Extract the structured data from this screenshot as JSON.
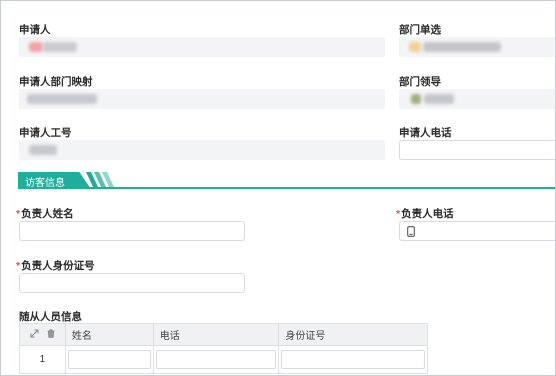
{
  "applicant_section": {
    "applicant": {
      "label": "申请人"
    },
    "dept_select": {
      "label": "部门单选"
    },
    "applicant_dept_mapping": {
      "label": "申请人部门映射"
    },
    "dept_leader": {
      "label": "部门领导"
    },
    "applicant_employee_id": {
      "label": "申请人工号"
    },
    "applicant_phone": {
      "label": "申请人电话",
      "value": ""
    }
  },
  "visitor_section": {
    "title": "访客信息",
    "owner_name": {
      "label": "负责人姓名",
      "required_mark": "*",
      "value": ""
    },
    "owner_phone": {
      "label": "负责人电话",
      "required_mark": "*",
      "value": ""
    },
    "owner_id_number": {
      "label": "负责人身份证号",
      "required_mark": "*",
      "value": ""
    },
    "companions": {
      "label": "随从人员信息",
      "columns": [
        "姓名",
        "电话",
        "身份证号"
      ],
      "rows": [
        {
          "index": "1",
          "name": "",
          "phone": "",
          "id_number": ""
        }
      ]
    }
  },
  "colors": {
    "accent": "#1fae9a",
    "required": "#e0503f",
    "readonly_bg": "#f3f4f6"
  },
  "icons": {
    "phone_field": "phone-icon",
    "expand": "expand-icon",
    "delete": "trash-icon"
  }
}
